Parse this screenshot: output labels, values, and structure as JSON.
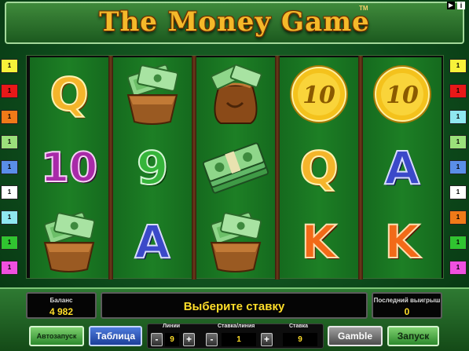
{
  "header": {
    "title": "The Money Game",
    "tm": "TM",
    "sound_icon": "▶",
    "info_icon": "i"
  },
  "reels": [
    [
      {
        "type": "letter",
        "text": "Q",
        "cls": "sym-Q",
        "name": "symbol-q"
      },
      {
        "type": "letter",
        "text": "10",
        "cls": "sym-10",
        "name": "symbol-10"
      },
      {
        "type": "wallet",
        "name": "symbol-wallet"
      }
    ],
    [
      {
        "type": "wallet",
        "name": "symbol-wallet"
      },
      {
        "type": "letter",
        "text": "9",
        "cls": "sym-9",
        "name": "symbol-9"
      },
      {
        "type": "letter",
        "text": "A",
        "cls": "sym-A",
        "name": "symbol-a"
      }
    ],
    [
      {
        "type": "moneybag",
        "name": "symbol-money-bag"
      },
      {
        "type": "cash",
        "name": "symbol-cash-stack"
      },
      {
        "type": "wallet",
        "name": "symbol-wallet"
      }
    ],
    [
      {
        "type": "coin",
        "text": "10",
        "name": "symbol-gold-coin"
      },
      {
        "type": "letter",
        "text": "Q",
        "cls": "sym-Q",
        "name": "symbol-q"
      },
      {
        "type": "letter",
        "text": "K",
        "cls": "sym-K",
        "name": "symbol-k"
      }
    ],
    [
      {
        "type": "coin",
        "text": "10",
        "name": "symbol-gold-coin"
      },
      {
        "type": "letter",
        "text": "A",
        "cls": "sym-A",
        "name": "symbol-a"
      },
      {
        "type": "letter",
        "text": "K",
        "cls": "sym-K",
        "name": "symbol-k"
      }
    ]
  ],
  "left_markers": [
    {
      "text": "1",
      "color": "#f7f23a"
    },
    {
      "text": "1",
      "color": "#e81818"
    },
    {
      "text": "1",
      "color": "#f07a18"
    },
    {
      "text": "1",
      "color": "#9be07a"
    },
    {
      "text": "1",
      "color": "#5a8ee8"
    },
    {
      "text": "1",
      "color": "#ffffff"
    },
    {
      "text": "1",
      "color": "#8fe8f0"
    },
    {
      "text": "1",
      "color": "#30c430"
    },
    {
      "text": "1",
      "color": "#f050e0"
    }
  ],
  "right_markers": [
    {
      "text": "1",
      "color": "#f7f23a"
    },
    {
      "text": "1",
      "color": "#e81818"
    },
    {
      "text": "1",
      "color": "#8fe8f0"
    },
    {
      "text": "1",
      "color": "#9be07a"
    },
    {
      "text": "1",
      "color": "#5a8ee8"
    },
    {
      "text": "1",
      "color": "#ffffff"
    },
    {
      "text": "1",
      "color": "#f07a18"
    },
    {
      "text": "1",
      "color": "#30c430"
    },
    {
      "text": "1",
      "color": "#f050e0"
    }
  ],
  "panel": {
    "balance_label": "Баланс",
    "balance_value": "4 982",
    "message": "Выберите ставку",
    "last_win_label": "Последний выигрыш",
    "last_win_value": "0",
    "autostart_label": "Автозапуск",
    "table_label": "Таблица",
    "lines_label": "Линии",
    "lines_value": "9",
    "bet_per_line_label": "Ставка/линия",
    "bet_per_line_value": "1",
    "bet_label": "Ставка",
    "bet_value": "9",
    "minus": "-",
    "plus": "+",
    "gamble_label": "Gamble",
    "start_label": "Запуск"
  }
}
